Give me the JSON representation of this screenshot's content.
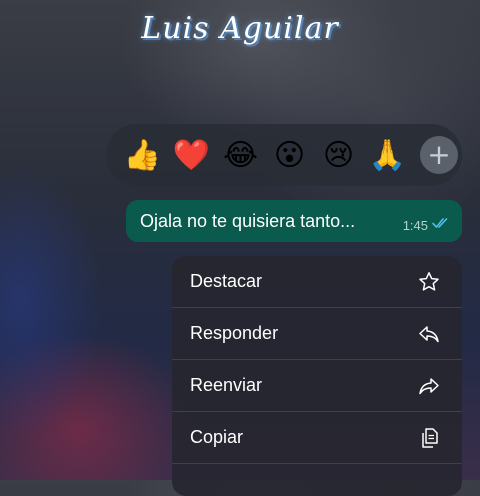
{
  "header": {
    "title": "Luis Aguilar"
  },
  "reactions": {
    "emojis": [
      {
        "name": "thumbs-up",
        "glyph": "👍"
      },
      {
        "name": "red-heart",
        "glyph": "❤️"
      },
      {
        "name": "face-with-tears-of-joy",
        "glyph": "😂"
      },
      {
        "name": "face-with-open-mouth",
        "glyph": "😮"
      },
      {
        "name": "crying-face",
        "glyph": "😢"
      },
      {
        "name": "folded-hands",
        "glyph": "🙏"
      }
    ],
    "add_label": "+"
  },
  "message": {
    "text": "Ojala no te quisiera tanto...",
    "time": "1:45",
    "status": "read",
    "bubble_color": "#0a5a4d",
    "tick_color": "#53bdeb"
  },
  "context_menu": {
    "items": [
      {
        "label": "Destacar",
        "icon": "star-icon"
      },
      {
        "label": "Responder",
        "icon": "reply-icon"
      },
      {
        "label": "Reenviar",
        "icon": "forward-icon"
      },
      {
        "label": "Copiar",
        "icon": "copy-icon"
      }
    ]
  }
}
